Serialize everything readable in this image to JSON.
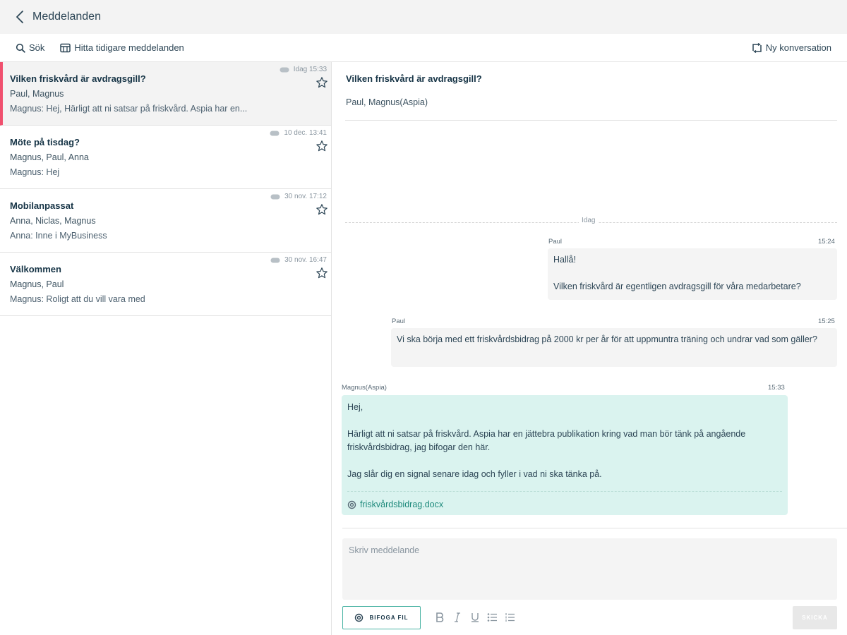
{
  "header": {
    "title": "Meddelanden"
  },
  "toolbar": {
    "search_label": "Sök",
    "history_label": "Hitta tidigare meddelanden",
    "new_conversation_label": "Ny konversation"
  },
  "conversations": [
    {
      "subject": "Vilken friskvård är avdragsgill?",
      "people": "Paul, Magnus",
      "preview": "Magnus: Hej,  Härligt att ni satsar på friskvård. Aspia har en...",
      "date": "Idag 15:33",
      "active": true
    },
    {
      "subject": "Möte på tisdag?",
      "people": "Magnus, Paul, Anna",
      "preview": "Magnus: Hej",
      "date": "10 dec. 13:41",
      "active": false
    },
    {
      "subject": "Mobilanpassat",
      "people": "Anna, Niclas, Magnus",
      "preview": "Anna: Inne i MyBusiness",
      "date": "30 nov. 17:12",
      "active": false
    },
    {
      "subject": "Välkommen",
      "people": "Magnus, Paul",
      "preview": "Magnus: Roligt att du vill vara med",
      "date": "30 nov. 16:47",
      "active": false
    }
  ],
  "thread": {
    "subject": "Vilken friskvård är avdragsgill?",
    "people": "Paul,  Magnus(Aspia)",
    "day_label": "Idag",
    "messages": [
      {
        "sender": "Paul",
        "time": "15:24",
        "lines": [
          "Hallå!",
          "Vilken friskvård är egentligen avdragsgill för våra medarbetare?"
        ]
      },
      {
        "sender": "Paul",
        "time": "15:25",
        "lines": [
          "Vi ska börja med ett friskvårdsbidrag på 2000 kr per år för att uppmuntra träning och undrar vad som gäller?"
        ]
      },
      {
        "sender": "Magnus(Aspia)",
        "time": "15:33",
        "lines": [
          "Hej,",
          "Härligt att ni satsar på friskvård. Aspia har en jättebra publikation kring vad man bör tänk på angående friskvårdsbidrag, jag bifogar den här.",
          "Jag slår dig en signal senare idag och fyller i vad ni ska tänka på."
        ],
        "attachment": "friskvårdsbidrag.docx"
      }
    ]
  },
  "composer": {
    "placeholder": "Skriv meddelande",
    "attach_label": "BIFOGA FIL",
    "send_label": "SKICKA",
    "format_tools": [
      "bold",
      "italic",
      "underline",
      "bulleted-list",
      "numbered-list"
    ]
  },
  "colors": {
    "accent": "#49b3a3",
    "active_marker": "#f0506e",
    "incoming_bubble": "#daf3ef",
    "outgoing_bubble": "#f4f4f4"
  }
}
